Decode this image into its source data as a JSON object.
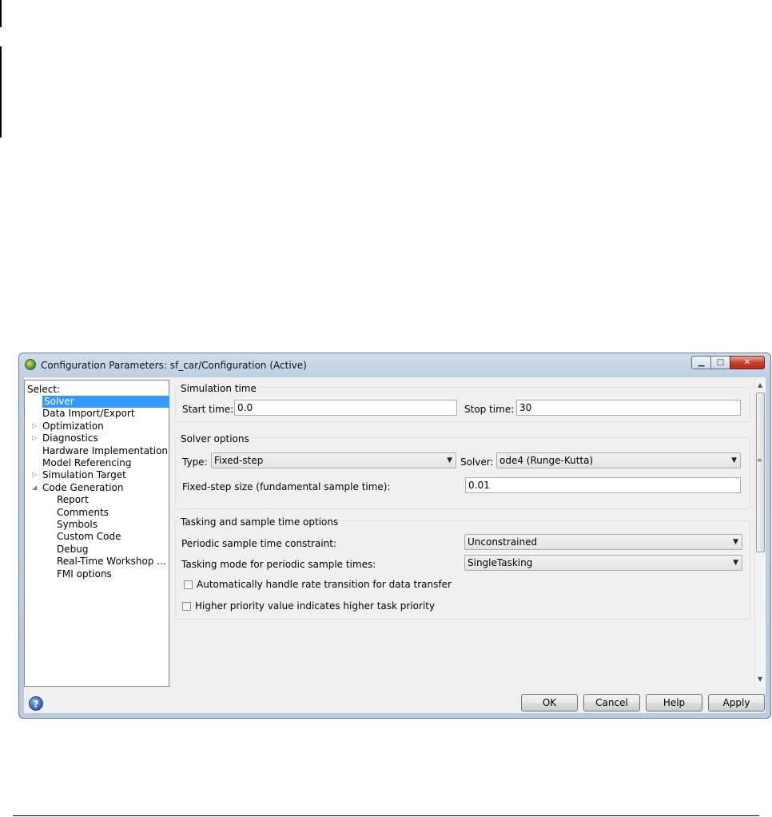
{
  "window": {
    "title": "Configuration Parameters: sf_car/Configuration (Active)",
    "minimize_glyph": "▁",
    "maximize_glyph": "□",
    "close_glyph": "✕"
  },
  "tree": {
    "header": "Select:",
    "items": [
      {
        "label": "Solver",
        "level": 1,
        "selected": true
      },
      {
        "label": "Data Import/Export",
        "level": 1
      },
      {
        "label": "Optimization",
        "level": 1,
        "expander": "▷"
      },
      {
        "label": "Diagnostics",
        "level": 1,
        "expander": "▷"
      },
      {
        "label": "Hardware Implementation",
        "level": 1
      },
      {
        "label": "Model Referencing",
        "level": 1
      },
      {
        "label": "Simulation Target",
        "level": 1,
        "expander": "▷"
      },
      {
        "label": "Code Generation",
        "level": 1,
        "expander": "◢"
      },
      {
        "label": "Report",
        "level": 2
      },
      {
        "label": "Comments",
        "level": 2
      },
      {
        "label": "Symbols",
        "level": 2
      },
      {
        "label": "Custom Code",
        "level": 2
      },
      {
        "label": "Debug",
        "level": 2
      },
      {
        "label": "Real-Time Workshop ...",
        "level": 2
      },
      {
        "label": "FMI options",
        "level": 2
      }
    ]
  },
  "simulation_time": {
    "title": "Simulation time",
    "start_label": "Start time:",
    "start_value": "0.0",
    "stop_label": "Stop time:",
    "stop_value": "30"
  },
  "solver_options": {
    "title": "Solver options",
    "type_label": "Type:",
    "type_value": "Fixed-step",
    "solver_label": "Solver:",
    "solver_value": "ode4 (Runge-Kutta)",
    "step_label": "Fixed-step size (fundamental sample time):",
    "step_value": "0.01"
  },
  "tasking": {
    "title": "Tasking and sample time options",
    "constraint_label": "Periodic sample time constraint:",
    "constraint_value": "Unconstrained",
    "mode_label": "Tasking mode for periodic sample times:",
    "mode_value": "SingleTasking",
    "auto_rate_label": "Automatically handle rate transition for data transfer",
    "auto_rate_checked": false,
    "priority_label": "Higher priority value indicates higher task priority",
    "priority_checked": false
  },
  "scrollbar": {
    "up": "▲",
    "down": "▼",
    "grip": "≡"
  },
  "footer": {
    "help_icon_glyph": "?",
    "ok": "OK",
    "cancel": "Cancel",
    "help": "Help",
    "apply": "Apply"
  },
  "icons": {
    "caret": "▼"
  }
}
